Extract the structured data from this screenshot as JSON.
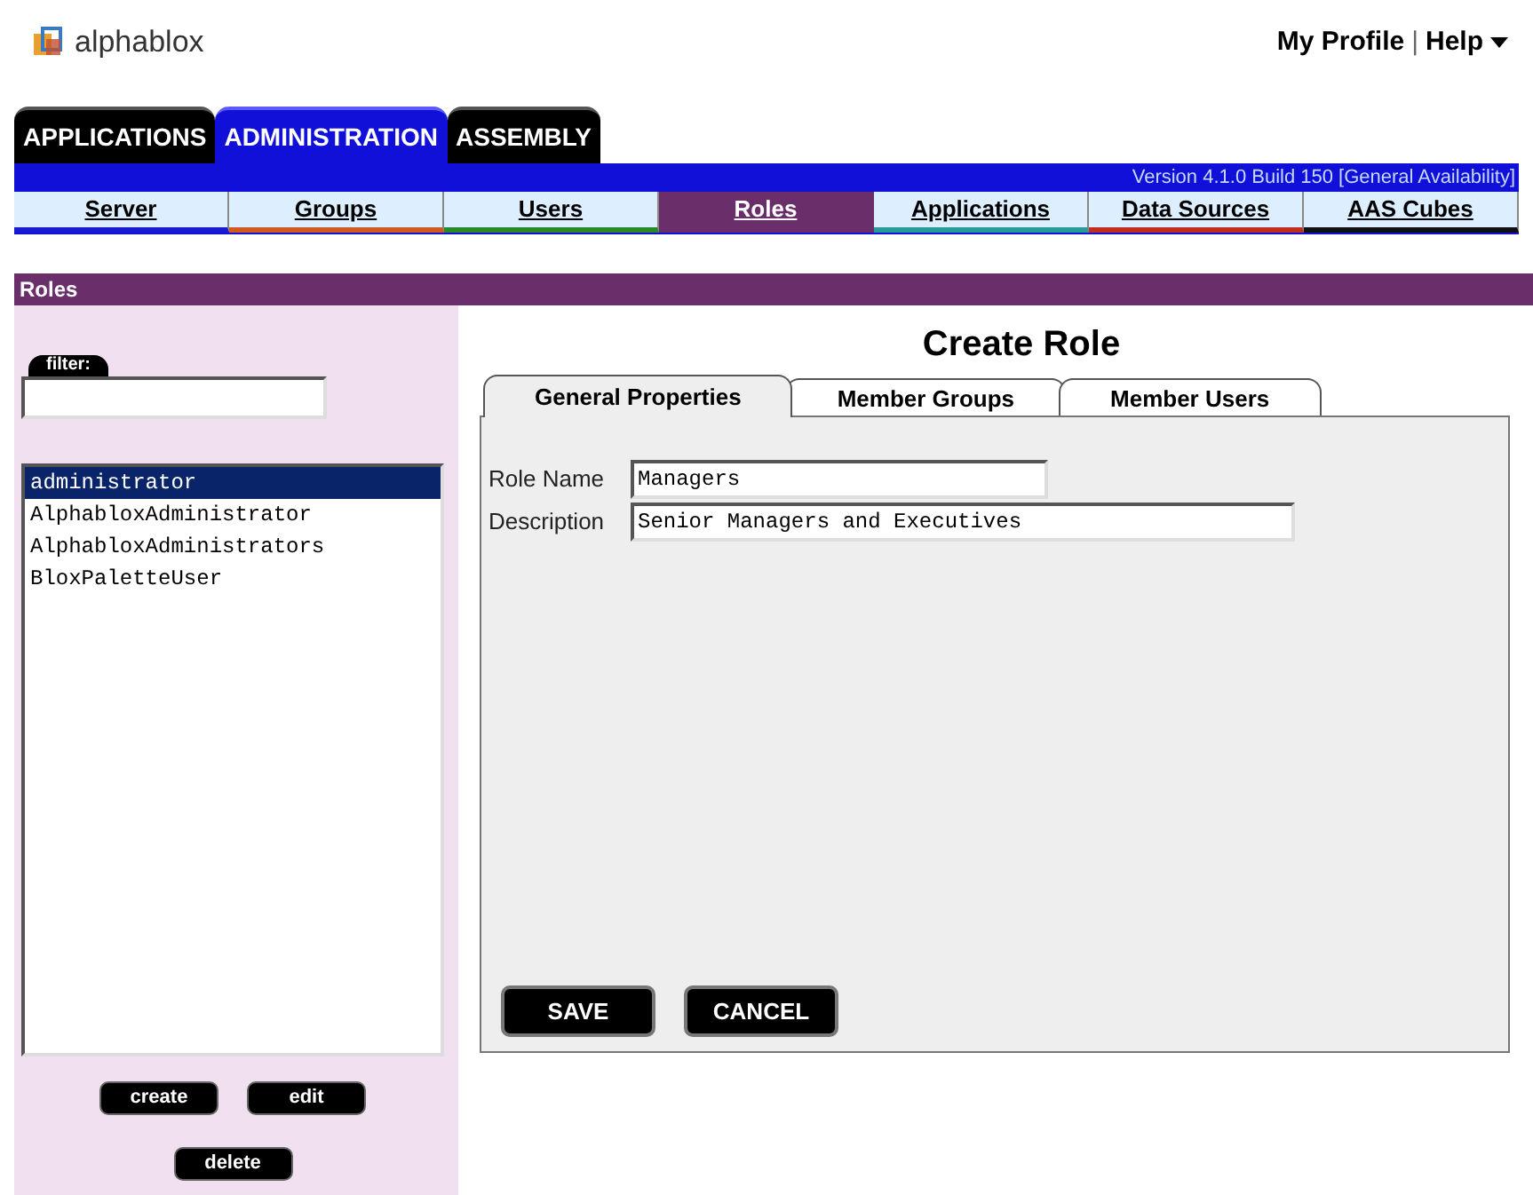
{
  "header": {
    "logo": "alphablox",
    "links": [
      "My Profile",
      "Help"
    ],
    "separator": "|"
  },
  "main_tabs": [
    {
      "label": "APPLICATIONS",
      "selected": false
    },
    {
      "label": "ADMINISTRATION",
      "selected": true
    },
    {
      "label": "ASSEMBLY",
      "selected": false
    }
  ],
  "version": "Version 4.1.0 Build 150 [General Availability]",
  "sub_tabs": [
    {
      "label": "Server",
      "selected": false,
      "color": "#1a1ad0"
    },
    {
      "label": "Groups",
      "selected": false,
      "color": "#d05a20"
    },
    {
      "label": "Users",
      "selected": false,
      "color": "#2a8a2a"
    },
    {
      "label": "Roles",
      "selected": true,
      "color": "#6a2e6a"
    },
    {
      "label": "Applications",
      "selected": false,
      "color": "#2a9a9a"
    },
    {
      "label": "Data Sources",
      "selected": false,
      "color": "#c03020"
    },
    {
      "label": "AAS Cubes",
      "selected": false,
      "color": "#111111"
    }
  ],
  "section_title": "Roles",
  "sidebar": {
    "filter_label": "filter:",
    "items": [
      {
        "label": "administrator",
        "selected": true
      },
      {
        "label": "AlphabloxAdministrator",
        "selected": false
      },
      {
        "label": "AlphabloxAdministrators",
        "selected": false
      },
      {
        "label": "BloxPaletteUser",
        "selected": false
      }
    ],
    "buttons": [
      "create",
      "edit",
      "delete"
    ]
  },
  "form": {
    "title": "Create Role",
    "tabs": [
      {
        "label": "General Properties",
        "selected": true
      },
      {
        "label": "Member Groups",
        "selected": false
      },
      {
        "label": "Member Users",
        "selected": false
      }
    ],
    "fields": [
      {
        "label": "Role Name",
        "value": "Managers"
      },
      {
        "label": "Description",
        "value": "Senior Managers and Executives"
      }
    ],
    "buttons": [
      "SAVE",
      "CANCEL"
    ]
  }
}
